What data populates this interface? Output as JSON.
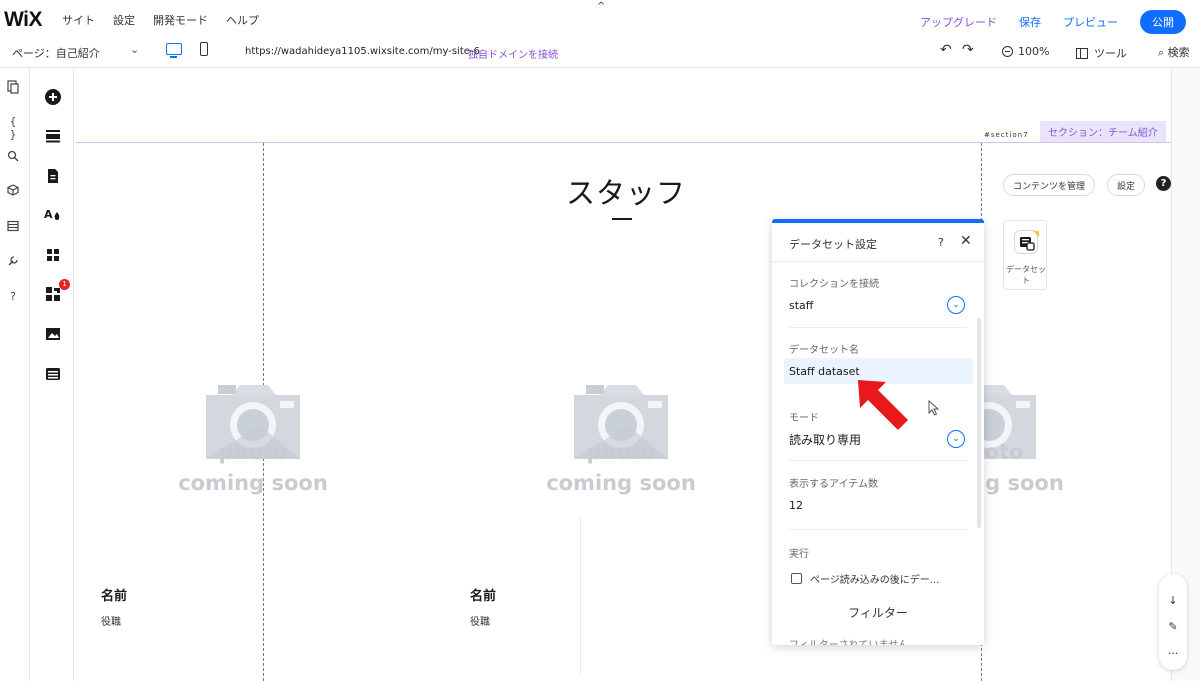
{
  "topbar": {
    "logo": "WiX",
    "menu": [
      "サイト",
      "設定",
      "開発モード",
      "ヘルプ"
    ],
    "upgrade": "アップグレード",
    "save": "保存",
    "preview": "プレビュー",
    "publish": "公開"
  },
  "subbar": {
    "page": "ページ：自己紹介",
    "url": "https://wadahideya1105.wixsite.com/my-site-6",
    "domain_link": "独自ドメインを接続",
    "zoom": "100%",
    "tools": "ツール",
    "search": "検索"
  },
  "left_rail": {
    "items": [
      "pages-icon",
      "code-icon",
      "search-icon",
      "box-icon",
      "table-icon",
      "tools-icon",
      "help-icon"
    ],
    "code_glyph": "{ }",
    "help_glyph": "?"
  },
  "tool_rail": {
    "items": [
      "add-icon",
      "sections-icon",
      "page-icon",
      "theme-icon",
      "apps-icon",
      "business-icon",
      "media-icon",
      "cms-icon"
    ],
    "badge_count": "1"
  },
  "canvas": {
    "section_id": "#section7",
    "section_tag": "セクション：チーム紹介",
    "title": "スタッフ",
    "photo_text_line1": "photo",
    "photo_text_line2": "coming soon",
    "cards": [
      {
        "name": "名前",
        "role": "役職"
      },
      {
        "name": "名前",
        "role": "役職"
      }
    ],
    "manage_content": "コンテンツを管理",
    "settings": "設定",
    "help": "?",
    "dataset_label": "データセット"
  },
  "dataset_panel": {
    "title": "データセット設定",
    "help": "?",
    "close": "✕",
    "collection_label": "コレクションを接続",
    "collection_value": "staff",
    "name_label": "データセット名",
    "name_value": "Staff dataset",
    "mode_label": "モード",
    "mode_value": "読み取り専用",
    "items_label": "表示するアイテム数",
    "items_value": "12",
    "run_label": "実行",
    "run_checkbox": "ページ読み込みの後にデー...",
    "filter_button": "フィルター",
    "filter_note": "フィルターされていません"
  },
  "float_tools": {
    "down": "↓",
    "pen": "✎",
    "more": "..."
  }
}
